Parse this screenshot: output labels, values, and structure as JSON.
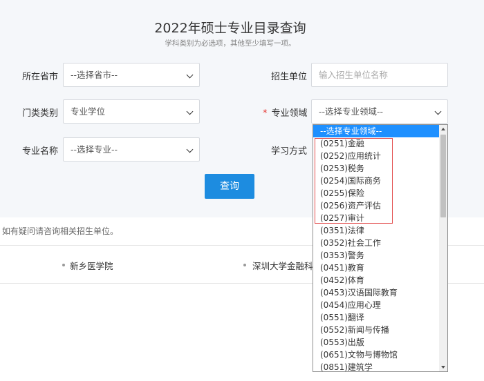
{
  "page": {
    "title": "2022年硕士专业目录查询",
    "subtitle": "学科类别为必选项，其他至少填写一项。"
  },
  "form": {
    "province_label": "所在省市",
    "province_value": "--选择省市--",
    "school_label": "招生单位",
    "school_placeholder": "输入招生单位名称",
    "category_label": "门类类别",
    "category_value": "专业学位",
    "field_required_mark": "*",
    "field_label": "专业领域",
    "field_value": "--选择专业领域--",
    "major_label": "专业名称",
    "major_value": "--选择专业--",
    "mode_label": "学习方式",
    "query_button": "查询"
  },
  "notice": "如有疑问请咨询相关招生单位。",
  "units": [
    "新乡医学院",
    "深圳大学金融科"
  ],
  "dropdown": {
    "items": [
      "--选择专业领域--",
      "(0251)金融",
      "(0252)应用统计",
      "(0253)税务",
      "(0254)国际商务",
      "(0255)保险",
      "(0256)资产评估",
      "(0257)审计",
      "(0351)法律",
      "(0352)社会工作",
      "(0353)警务",
      "(0451)教育",
      "(0452)体育",
      "(0453)汉语国际教育",
      "(0454)应用心理",
      "(0551)翻译",
      "(0552)新闻与传播",
      "(0553)出版",
      "(0651)文物与博物馆",
      "(0851)建筑学"
    ]
  },
  "colors": {
    "accent": "#1d8ce0",
    "selected": "#1e90ff",
    "highlight": "#e24a4a"
  }
}
